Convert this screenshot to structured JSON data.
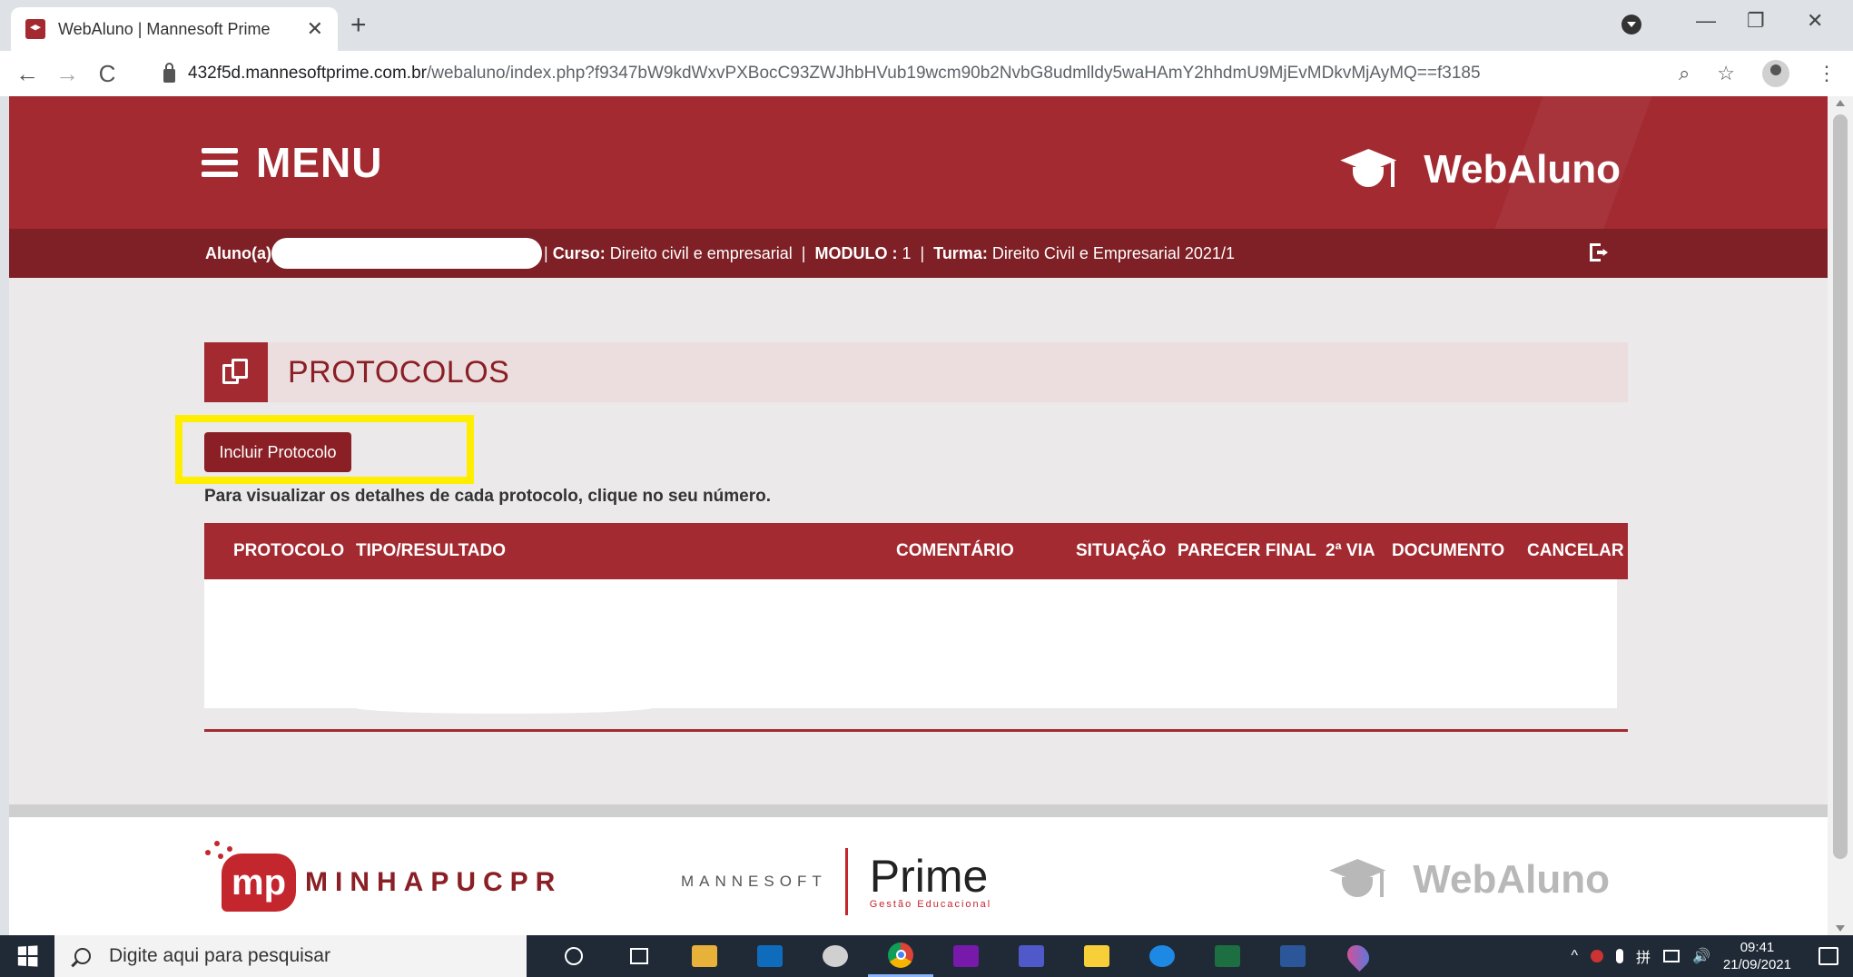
{
  "browser": {
    "tab_title": "WebAluno | Mannesoft Prime",
    "tab_close": "✕",
    "new_tab": "+",
    "url_host": "432f5d.mannesoftprime.com.br",
    "url_path": "/webaluno/index.php?f9347bW9kdWxvPXBocC93ZWJhbHVub19wcm90b2NvbG8udmlldy5waHAmY2hhdmU9MjEvMDkvMjAyMQ==f3185",
    "back": "←",
    "forward": "→",
    "reload": "C",
    "minimize": "—",
    "restore": "❐",
    "close": "✕",
    "zoom_icon": "⌕",
    "star_icon": "☆",
    "more_icon": "⋮"
  },
  "header": {
    "menu_label": "MENU",
    "brand": "WebAluno"
  },
  "infobar": {
    "student_label": "Aluno(a)",
    "course_label": "Curso:",
    "course_value": "Direito civil e empresarial",
    "module_label": "MODULO :",
    "module_value": "1",
    "class_label": "Turma:",
    "class_value": "Direito Civil e Empresarial 2021/1",
    "divider": "|"
  },
  "panel": {
    "title": "PROTOCOLOS",
    "button_label": "Incluir Protocolo",
    "hint": "Para visualizar os detalhes de cada protocolo, clique no seu número."
  },
  "table": {
    "columns": [
      "PROTOCOLO",
      "TIPO/RESULTADO",
      "COMENTÁRIO",
      "SITUAÇÃO",
      "PARECER FINAL",
      "2ª VIA",
      "DOCUMENTO",
      "CANCELAR"
    ]
  },
  "footer": {
    "mp_badge": "mp",
    "mp_text": "MINHAPUCPR",
    "mannesoft": "MANNESOFT",
    "prime": "Prime",
    "prime_sub": "Gestão Educacional",
    "brand": "WebAluno"
  },
  "taskbar": {
    "search_placeholder": "Digite aqui para pesquisar",
    "time": "09:41",
    "date": "21/09/2021",
    "tray_chevron": "^",
    "tray_keyboard": "拼",
    "tray_sound": "🔊"
  },
  "colors": {
    "brand_red": "#a22a30",
    "dark_red": "#7e2025",
    "highlight": "#ffee00"
  }
}
